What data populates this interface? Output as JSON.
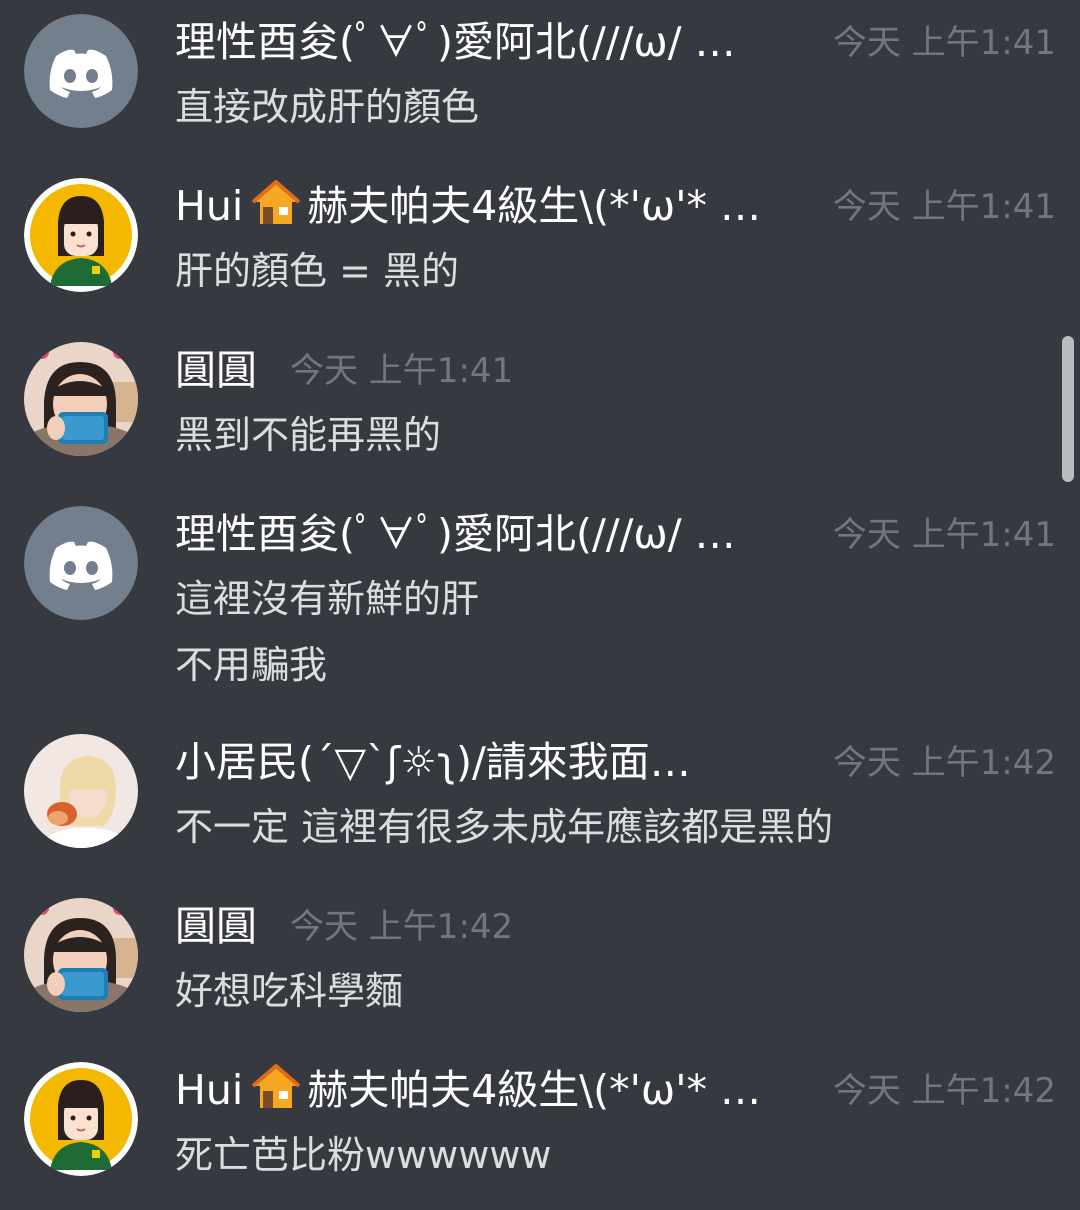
{
  "colors": {
    "background": "#36393f",
    "username": "#ffffff",
    "message_text": "#dcddde",
    "timestamp": "#72767d",
    "discord_default_avatar_bg": "#747f8d",
    "yellow_avatar_bg": "#f5b800",
    "scrollbar": "#b9bbbe"
  },
  "messages": [
    {
      "author": "理性酉夋(ﾟ∀ﾟ)愛阿北(///ω/ …",
      "time": "今天 上午1:41",
      "lines": [
        "直接改成肝的顏色"
      ],
      "avatar": "discord-default-avatar"
    },
    {
      "author_prefix": "Hui",
      "author_icon": "house-emoji-icon",
      "author_suffix": "赫夫帕夫4級生\\(*'ω'* …",
      "time": "今天 上午1:41",
      "lines": [
        "肝的顏色 = 黑的"
      ],
      "avatar": "cartoon-girl-avatar"
    },
    {
      "author": "圓圓",
      "time": "今天 上午1:41",
      "lines": [
        "黑到不能再黑的"
      ],
      "avatar": "photo-avatar-phone"
    },
    {
      "author": "理性酉夋(ﾟ∀ﾟ)愛阿北(///ω/ …",
      "time": "今天 上午1:41",
      "lines": [
        "這裡沒有新鮮的肝",
        "不用騙我"
      ],
      "avatar": "discord-default-avatar"
    },
    {
      "author": "小居民(´▽`ʃ☼ʅ)/請來我面…",
      "time": "今天 上午1:42",
      "lines": [
        "不一定  這裡有很多未成年應該都是黑的"
      ],
      "avatar": "photo-avatar-blonde"
    },
    {
      "author": "圓圓",
      "time": "今天 上午1:42",
      "lines": [
        "好想吃科學麵"
      ],
      "avatar": "photo-avatar-phone"
    },
    {
      "author_prefix": "Hui",
      "author_icon": "house-emoji-icon",
      "author_suffix": "赫夫帕夫4級生\\(*'ω'* …",
      "time": "今天 上午1:42",
      "lines": [
        "死亡芭比粉wwwwww"
      ],
      "avatar": "cartoon-girl-avatar"
    }
  ]
}
